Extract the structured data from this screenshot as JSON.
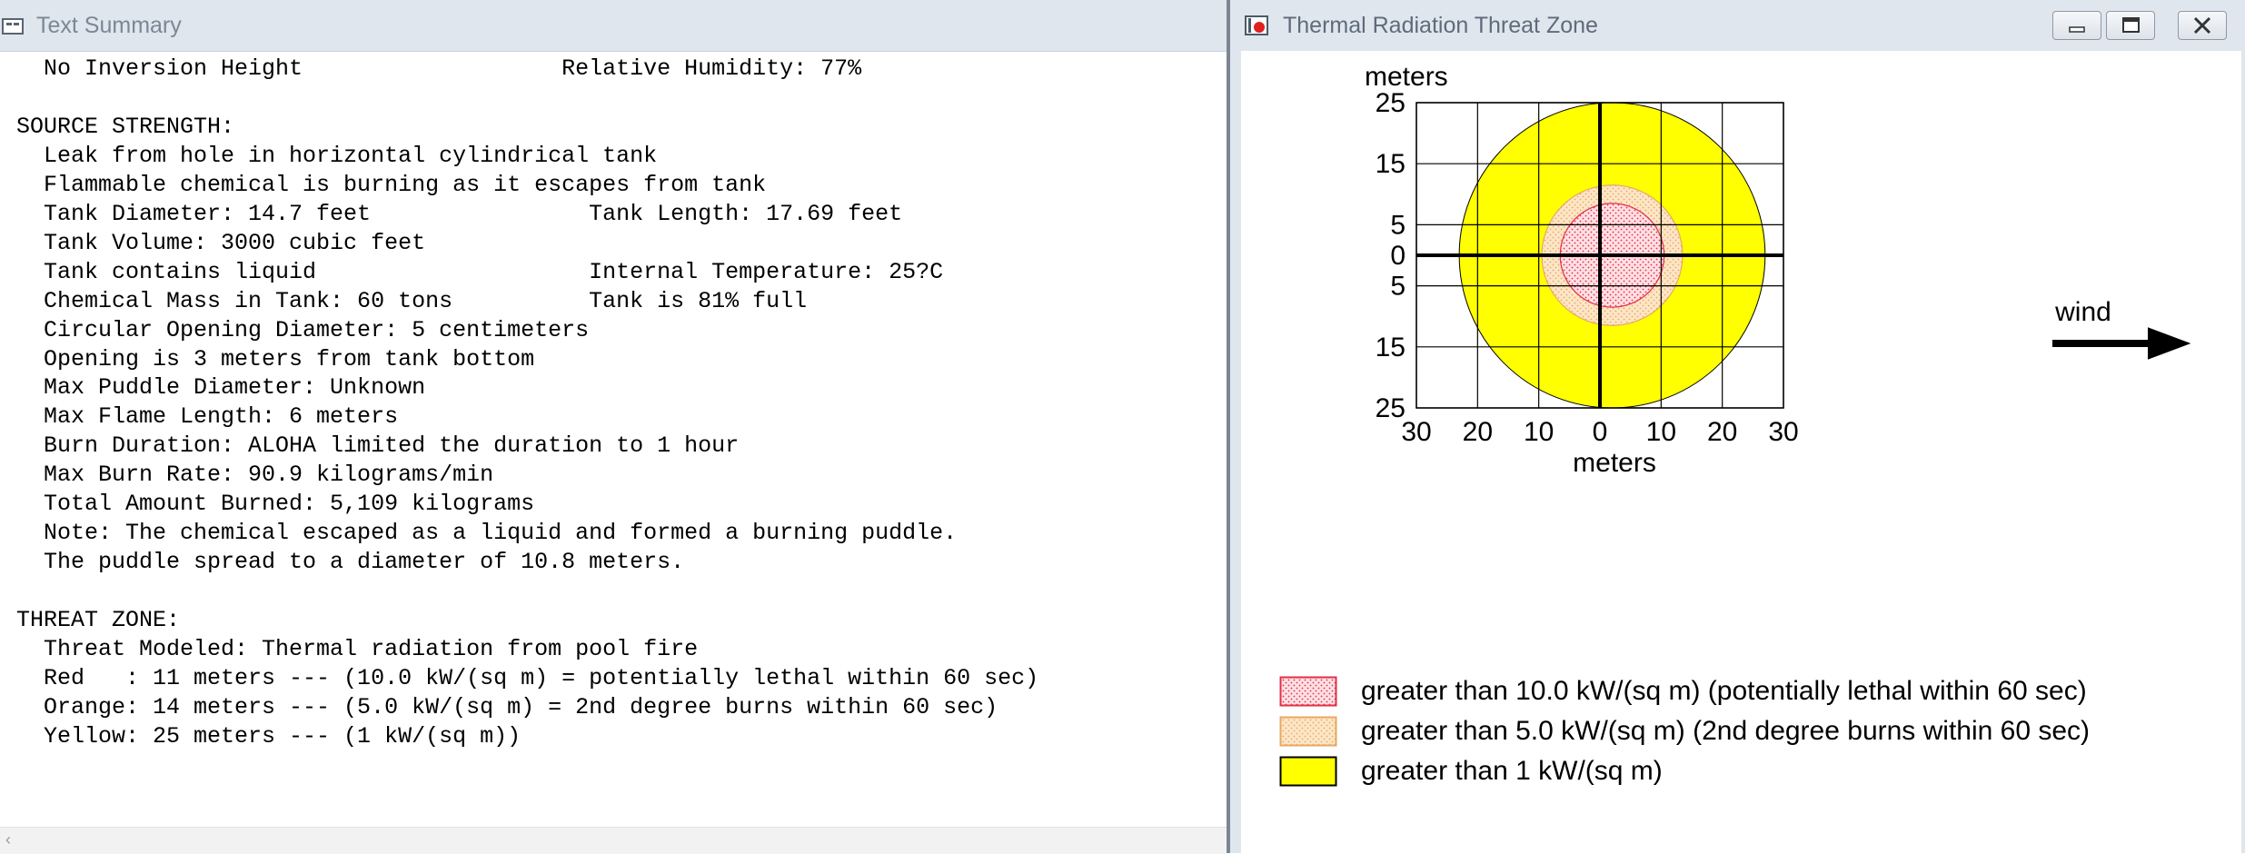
{
  "text_window": {
    "title": "Text Summary",
    "lines": [
      "  No Inversion Height                   Relative Humidity: 77%",
      "",
      "SOURCE STRENGTH:",
      "  Leak from hole in horizontal cylindrical tank",
      "  Flammable chemical is burning as it escapes from tank",
      "  Tank Diameter: 14.7 feet                Tank Length: 17.69 feet",
      "  Tank Volume: 3000 cubic feet",
      "  Tank contains liquid                    Internal Temperature: 25?C",
      "  Chemical Mass in Tank: 60 tons          Tank is 81% full",
      "  Circular Opening Diameter: 5 centimeters",
      "  Opening is 3 meters from tank bottom",
      "  Max Puddle Diameter: Unknown",
      "  Max Flame Length: 6 meters",
      "  Burn Duration: ALOHA limited the duration to 1 hour",
      "  Max Burn Rate: 90.9 kilograms/min",
      "  Total Amount Burned: 5,109 kilograms",
      "  Note: The chemical escaped as a liquid and formed a burning puddle.",
      "  The puddle spread to a diameter of 10.8 meters.",
      "",
      "THREAT ZONE:",
      "  Threat Modeled: Thermal radiation from pool fire",
      "  Red   : 11 meters --- (10.0 kW/(sq m) = potentially lethal within 60 sec)",
      "  Orange: 14 meters --- (5.0 kW/(sq m) = 2nd degree burns within 60 sec)",
      "  Yellow: 25 meters --- (1 kW/(sq m))"
    ]
  },
  "threat_window": {
    "title": "Thermal Radiation Threat Zone",
    "icons": {
      "app": "threat-zone-icon",
      "minimize": "minimize-icon",
      "maximize": "maximize-icon",
      "close": "close-icon"
    }
  },
  "chart_data": {
    "type": "threat-zone",
    "y_axis_label": "meters",
    "x_axis_label": "meters",
    "wind_label": "wind",
    "xlim": [
      -30,
      30
    ],
    "ylim": [
      -25,
      25
    ],
    "x_ticks": [
      -30,
      -20,
      -10,
      0,
      10,
      20,
      30
    ],
    "x_tick_labels": [
      "30",
      "20",
      "10",
      "0",
      "10",
      "20",
      "30"
    ],
    "y_ticks": [
      25,
      15,
      5,
      0,
      -5,
      -15,
      -25
    ],
    "y_tick_labels": [
      "25",
      "15",
      "5",
      "0",
      "5",
      "15",
      "25"
    ],
    "grid": true,
    "zones": [
      {
        "name": "yellow",
        "center_x": 2,
        "center_y": 0,
        "radius": 25,
        "fill": "#ffff00",
        "pattern": "solid"
      },
      {
        "name": "orange",
        "center_x": 2,
        "center_y": 0,
        "radius": 11.5,
        "fill": "#fde6c8",
        "dot": "#e8a860",
        "pattern": "dots"
      },
      {
        "name": "red",
        "center_x": 2,
        "center_y": 0,
        "radius": 8.5,
        "fill": "#ffe0e4",
        "dot": "#e03048",
        "pattern": "dots"
      }
    ],
    "legend": [
      {
        "label": "greater than 10.0 kW/(sq m) (potentially lethal within 60 sec)",
        "fill": "#ffe0e4",
        "border": "#e03048",
        "pattern": "dots"
      },
      {
        "label": "greater than 5.0 kW/(sq m) (2nd degree burns within 60 sec)",
        "fill": "#fde6c8",
        "border": "#e8a860",
        "pattern": "dots"
      },
      {
        "label": "greater than 1 kW/(sq m)",
        "fill": "#ffff00",
        "border": "#000000",
        "pattern": "solid"
      }
    ],
    "colors": {
      "red_zone": "#e03048",
      "orange_zone": "#e8a860",
      "yellow_zone": "#ffff00"
    }
  }
}
